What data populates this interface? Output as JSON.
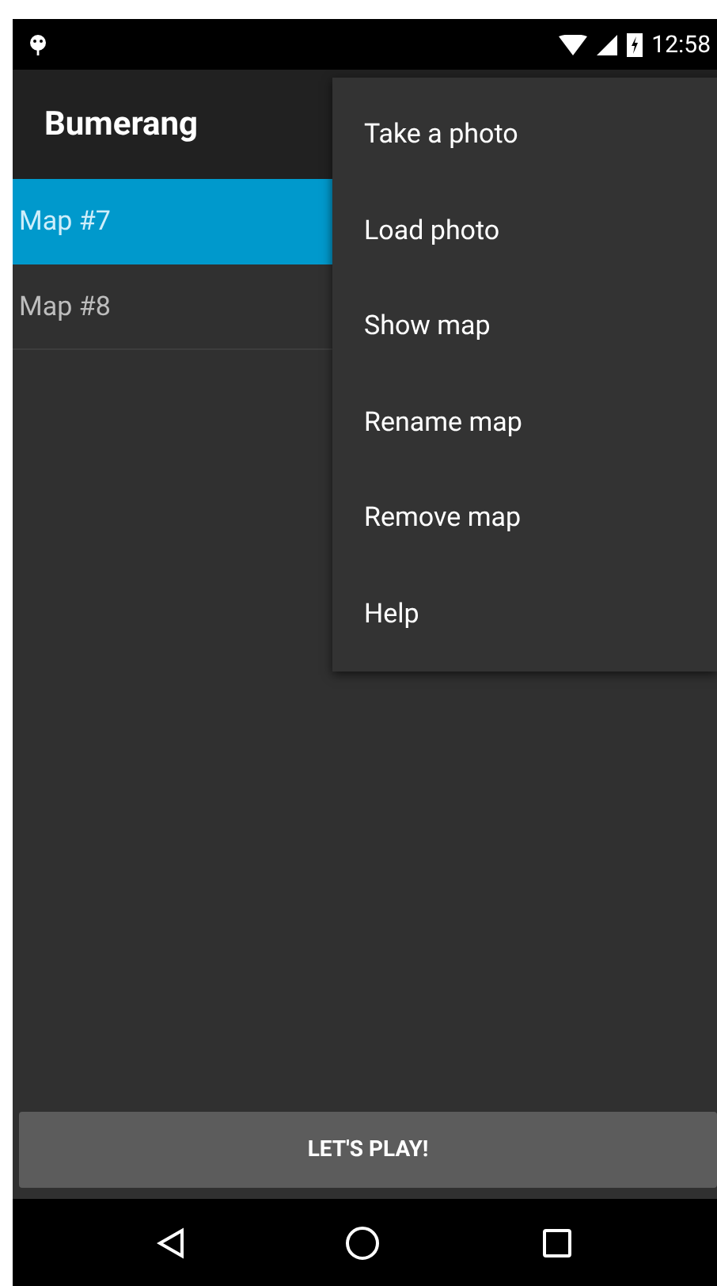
{
  "status_bar": {
    "time": "12:58"
  },
  "app_bar": {
    "title": "Bumerang"
  },
  "maps": [
    {
      "label": "Map #7",
      "selected": true
    },
    {
      "label": "Map #8",
      "selected": false
    }
  ],
  "menu": {
    "items": [
      "Take a photo",
      "Load photo",
      "Show map",
      "Rename map",
      "Remove map",
      "Help"
    ]
  },
  "play_button": {
    "label": "LET'S PLAY!"
  }
}
